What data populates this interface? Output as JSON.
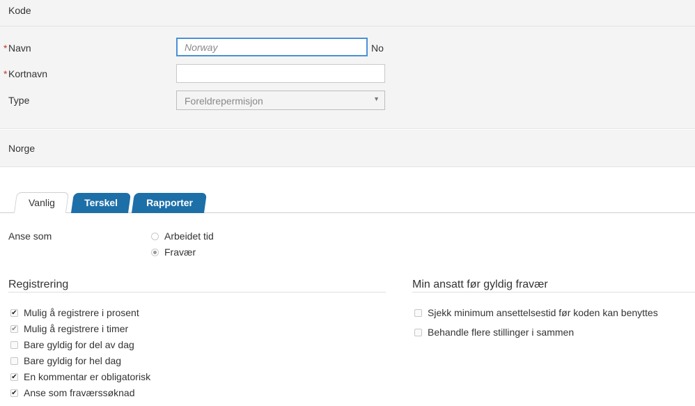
{
  "sections": {
    "kode_title": "Kode",
    "norge_title": "Norge"
  },
  "form": {
    "navn_label": "Navn",
    "navn_required_mark": "*",
    "navn_placeholder": "Norway",
    "navn_value": "",
    "navn_lang": "No",
    "kortnavn_label": "Kortnavn",
    "kortnavn_required_mark": "*",
    "kortnavn_value": "",
    "type_label": "Type",
    "type_selected": "Foreldrepermisjon",
    "type_arrow_icon": "triangle-down"
  },
  "tabs": [
    {
      "label": "Vanlig",
      "active": true
    },
    {
      "label": "Terskel",
      "active": false
    },
    {
      "label": "Rapporter",
      "active": false
    }
  ],
  "anse_som": {
    "label": "Anse som",
    "options": [
      {
        "label": "Arbeidet tid",
        "checked": false
      },
      {
        "label": "Fravær",
        "checked": true
      }
    ]
  },
  "registrering": {
    "title": "Registrering",
    "items": [
      {
        "label": "Mulig å registrere i prosent",
        "checked": true,
        "disabled": false
      },
      {
        "label": "Mulig å registrere i timer",
        "checked": true,
        "disabled": true
      },
      {
        "label": "Bare gyldig for del av dag",
        "checked": false,
        "disabled": false
      },
      {
        "label": "Bare gyldig for hel dag",
        "checked": false,
        "disabled": false
      },
      {
        "label": "En kommentar er obligatorisk",
        "checked": true,
        "disabled": false
      },
      {
        "label": "Anse som fraværssøknad",
        "checked": true,
        "disabled": false
      }
    ]
  },
  "min_ansatt": {
    "title": "Min ansatt før gyldig fravær",
    "items": [
      {
        "label": "Sjekk minimum ansettelsestid før koden kan benyttes",
        "checked": false
      },
      {
        "label": "Behandle flere stillinger i sammen",
        "checked": false
      }
    ]
  },
  "colors": {
    "tab_blue": "#1d6fa8",
    "focus_border": "#4a90d9",
    "required": "#c0392b",
    "section_bg": "#f4f4f4"
  }
}
